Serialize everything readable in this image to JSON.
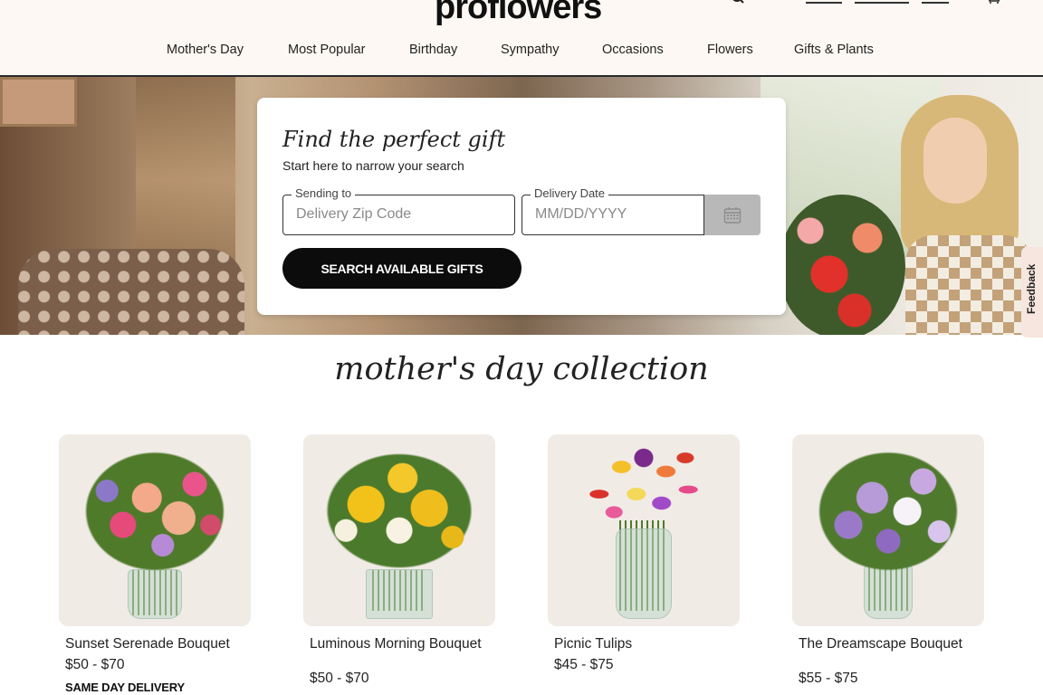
{
  "brand": {
    "logo_text": "proflowers"
  },
  "nav": {
    "items": [
      "Mother's Day",
      "Most Popular",
      "Birthday",
      "Sympathy",
      "Occasions",
      "Flowers",
      "Gifts & Plants"
    ]
  },
  "search_card": {
    "title": "Find the perfect gift",
    "subtitle": "Start here to narrow your search",
    "zip_label": "Sending to",
    "zip_placeholder": "Delivery Zip Code",
    "date_label": "Delivery Date",
    "date_placeholder": "MM/DD/YYYY",
    "calendar_icon": "calendar-icon",
    "button_label": "SEARCH AVAILABLE GIFTS"
  },
  "feedback": {
    "label": "Feedback"
  },
  "collection": {
    "title": "mother's day collection",
    "products": [
      {
        "name": "Sunset Serenade Bouquet",
        "price": "$50 - $70",
        "badge": "SAME DAY DELIVERY"
      },
      {
        "name": "Luminous Morning Bouquet",
        "price": "$50 - $70"
      },
      {
        "name": "Picnic Tulips",
        "price": "$45 - $75"
      },
      {
        "name": "The Dreamscape Bouquet",
        "price": "$55 - $75"
      }
    ]
  },
  "colors": {
    "header_bg": "#fdf8f3",
    "button_bg": "#0c0c0c",
    "calendar_button_bg": "#b8b8b8",
    "product_card_bg": "#f1ebe6"
  }
}
